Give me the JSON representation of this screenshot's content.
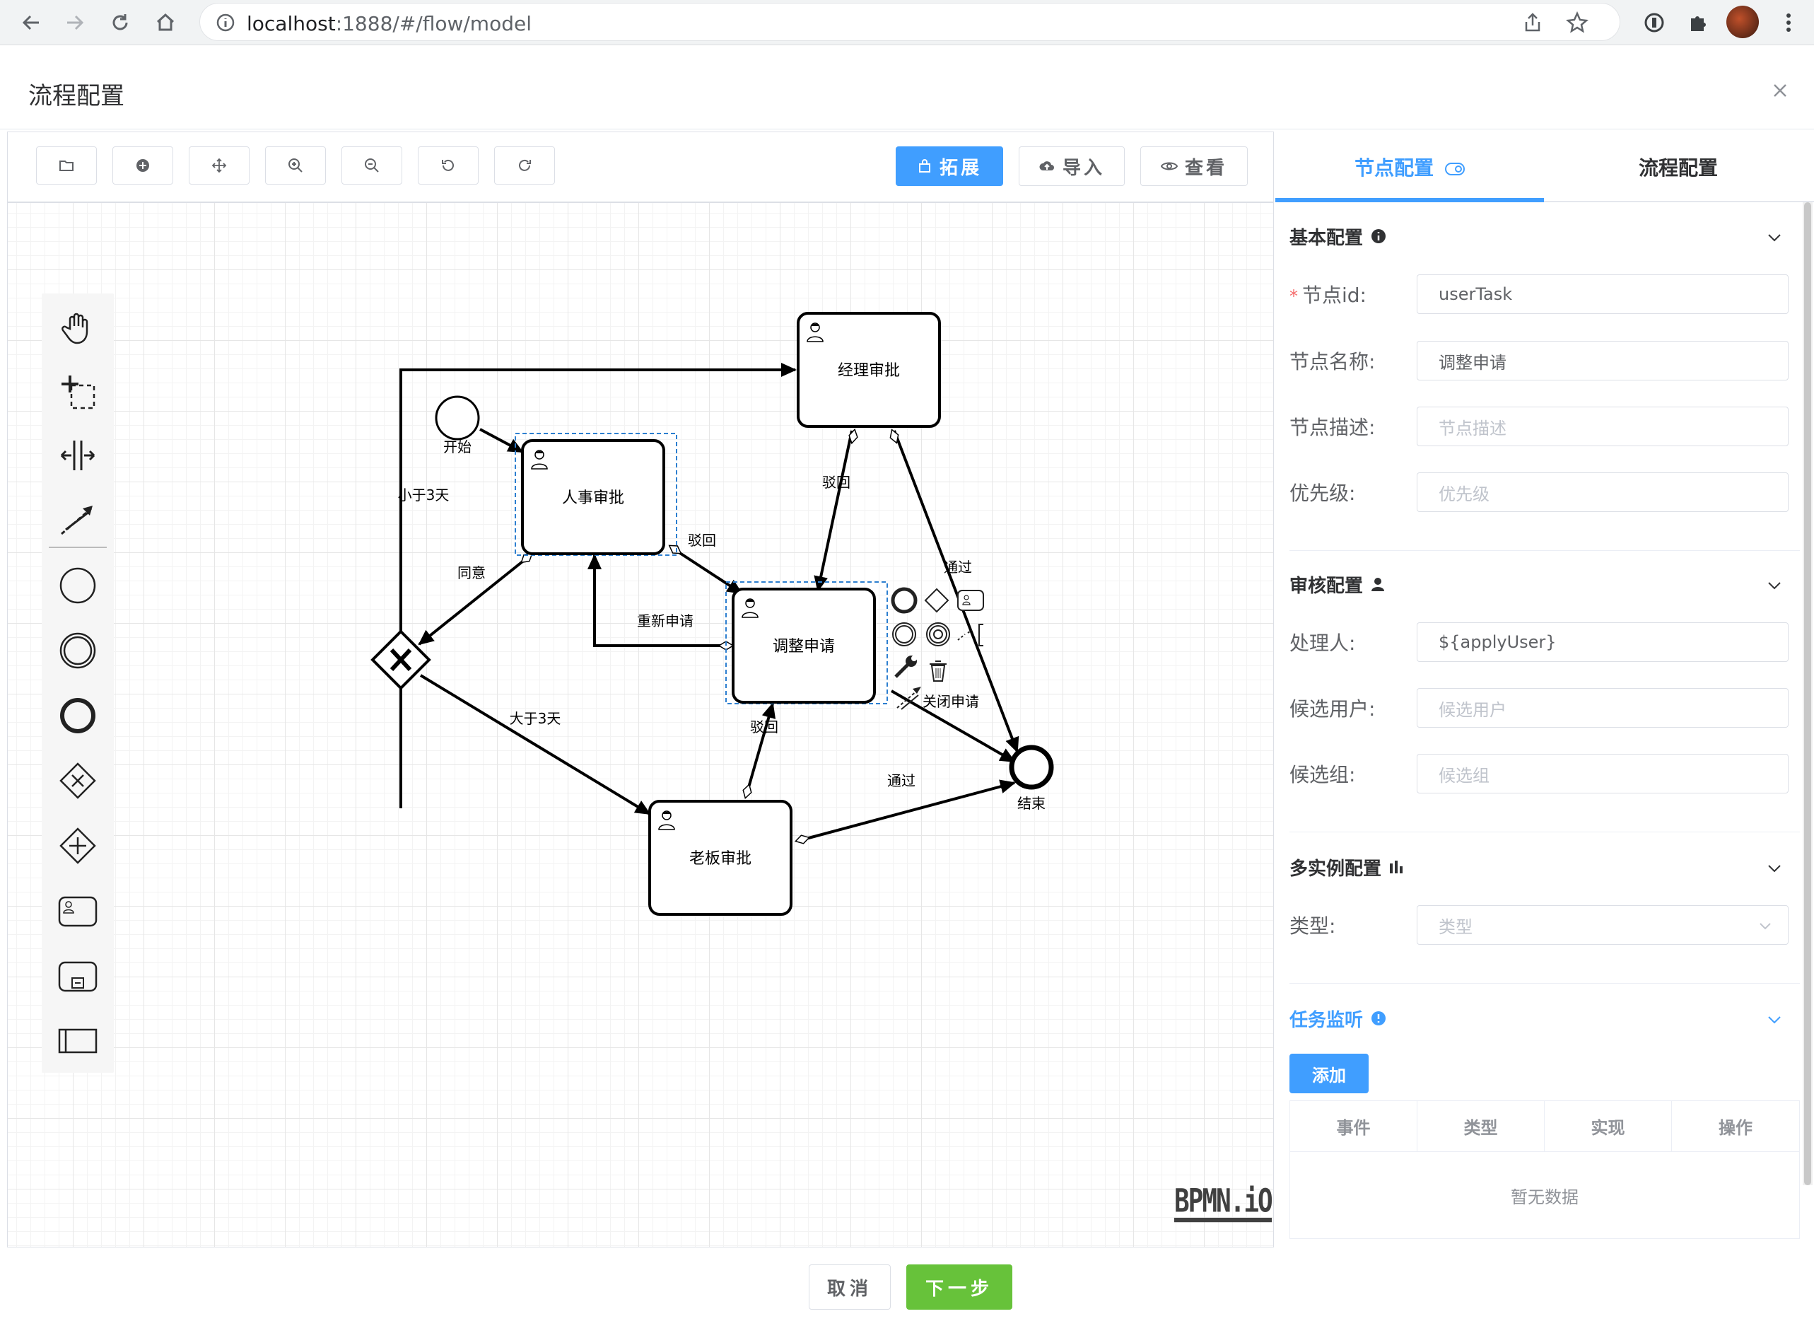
{
  "browser": {
    "url_host": "localhost",
    "url_rest": ":1888/#/flow/model"
  },
  "dialog": {
    "title": "流程配置"
  },
  "toolbar": {
    "extend_label": "拓展",
    "import_label": "导入",
    "view_label": "查看"
  },
  "diagram": {
    "nodes": {
      "start": "开始",
      "hr_approval": "人事审批",
      "manager_approval": "经理审批",
      "adjust_request": "调整申请",
      "boss_approval": "老板审批",
      "end": "结束"
    },
    "flows": {
      "less_than_3_days": "小于3天",
      "agree": "同意",
      "reject_hr": "驳回",
      "reapply": "重新申请",
      "reject_manager": "驳回",
      "pass_manager": "通过",
      "more_than_3_days": "大于3天",
      "reject_boss": "驳回",
      "pass_boss": "通过",
      "close_request": "关闭申请"
    },
    "logo": "BPMN.iO"
  },
  "panel": {
    "tabs": [
      "节点配置",
      "流程配置"
    ],
    "basic": {
      "title": "基本配置",
      "id_label": "节点id:",
      "id_value": "userTask",
      "name_label": "节点名称:",
      "name_value": "调整申请",
      "desc_label": "节点描述:",
      "desc_placeholder": "节点描述",
      "priority_label": "优先级:",
      "priority_placeholder": "优先级"
    },
    "review": {
      "title": "审核配置",
      "assignee_label": "处理人:",
      "assignee_value": "${applyUser}",
      "candidate_users_label": "候选用户:",
      "candidate_users_placeholder": "候选用户",
      "candidate_groups_label": "候选组:",
      "candidate_groups_placeholder": "候选组"
    },
    "multi": {
      "title": "多实例配置",
      "type_label": "类型:",
      "type_placeholder": "类型"
    },
    "listener": {
      "title": "任务监听",
      "add_label": "添加",
      "columns": [
        "事件",
        "类型",
        "实现",
        "操作"
      ],
      "empty_text": "暂无数据"
    }
  },
  "footer": {
    "cancel_label": "取消",
    "next_label": "下一步"
  },
  "colors": {
    "primary": "#409eff",
    "success": "#67c23a",
    "danger": "#f56c6c"
  }
}
